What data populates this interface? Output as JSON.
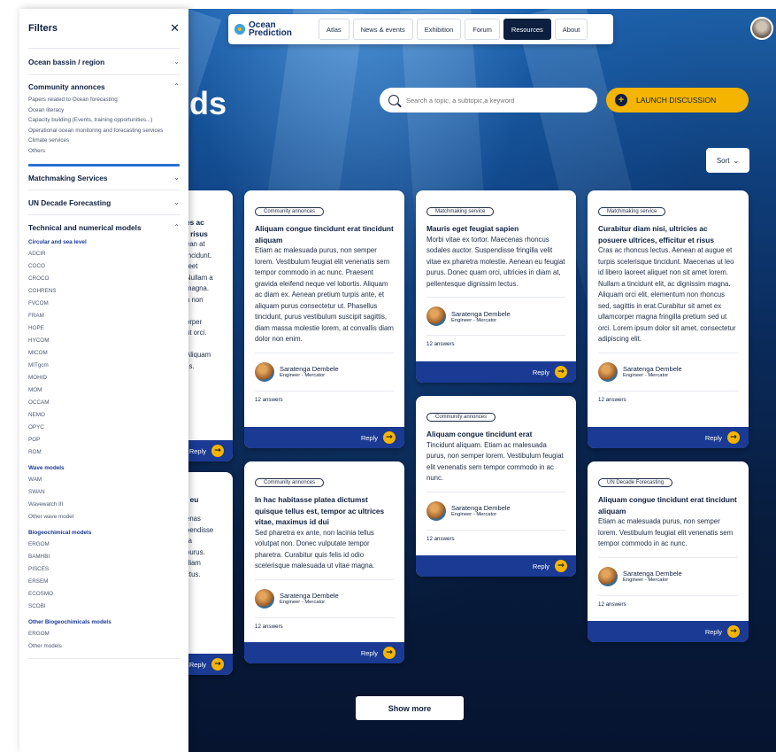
{
  "nav": {
    "logo_line1": "Ocean",
    "logo_line2": "Prediction",
    "items": [
      "Atlas",
      "News & events",
      "Exhibition",
      "Forum",
      "Resources",
      "About"
    ],
    "active": "Resources"
  },
  "hero": {
    "title_fragment": "ds"
  },
  "search": {
    "placeholder": "Search a topic, a subtopic,a keyword"
  },
  "launch_label": "LAUNCH DISCUSSION",
  "sort_label": "Sort",
  "show_more_label": "Show more",
  "filters": {
    "title": "Filters",
    "sections": {
      "ocean": "Ocean bassin / region",
      "community": "Community annonces",
      "community_items": [
        "Papers related to Ocean forecasting",
        "Ocean literacy",
        "Capacity building (Events, training opportunities...)",
        "Operational ocean monitoring and forecasting services",
        "Climate services",
        "Others"
      ],
      "matchmaking": "Matchmaking Services",
      "undecade": "UN Decade Forecasting",
      "technical": "Technical and numerical models",
      "circular_title": "Circular and sea level",
      "circular_items": [
        "ADCIR",
        "COCO",
        "CROCO",
        "COHRENS",
        "FVCOM",
        "FRAM",
        "HOPE",
        "HYCOM",
        "MICOM",
        "MITgcm",
        "MOHID",
        "MOM",
        "OCCAM",
        "NEMO",
        "OPYC",
        "POP",
        "ROM"
      ],
      "wave_title": "Wave models",
      "wave_items": [
        "WAM",
        "SWAN",
        "Wavewatch III",
        "Other wave model"
      ],
      "bio_title": "Biogeochimical models",
      "bio_items": [
        "ERGOM",
        "BAMHBI",
        "PISCES",
        "ERSEM",
        "ECOSMO",
        "SCOBI"
      ],
      "otherbio_title": "Other Biogeochimicals models",
      "otherbio_items": [
        "ERGOM",
        "Other models"
      ]
    }
  },
  "cards": {
    "c1": {
      "tag": "Community annonces",
      "title": "Aliquam congue tincidunt erat tincidunt aliquam",
      "body": "Etiam ac malesuada purus, non semper lorem. Vestibulum feugiat elit venenatis sem tempor commodo in ac nunc. Praesent gravida eleifend neque vel lobortis. Aliquam ac diam ex. Aenean pretium turpis ante, et aliquam purus consectetur ut. Phasellus tincidunt, purus vestibulum suscipit sagittis, diam massa molestie lorem, at convallis diam dolor non enim.",
      "author": "Saratenga Dembele",
      "role": "Engineer - Mercator",
      "answers": "12 answers",
      "reply": "Reply"
    },
    "c2": {
      "tag": "Matchmaking service",
      "title": "Mauris eget feugiat sapien",
      "body": "Morbi vitae ex tortor. Maecenas rhoncus sodales auctor. Suspendisse fringilla velit vitae ex pharetra molestie. Aenean eu feugiat purus. Donec quam orci, ultricies in diam at, pellentesque dignissim lectus.",
      "author": "Saratenga Dembele",
      "role": "Engineer - Mercator",
      "answers": "12 answers",
      "reply": "Reply"
    },
    "c3": {
      "tag": "Matchmaking service",
      "title": "Curabitur diam nisi, ultricies ac posuere ultrices, efficitur et risus",
      "body": "Cras ac rhoncus lectus. Aenean at augue et turpis scelerisque tincidunt. Maecenas ut leo id libero laoreet aliquet non sit amet lorem. Nullam a tincidunt elit, ac dignissim magna. Aliquam orci elit, elementum non rhoncus sed, sagittis in erat.Curabitur sit amet ex ullamcorper magna fringilla pretium sed ut orci. Lorem ipsum dolor sit amet, consectetur adipiscing elit.",
      "author": "Saratenga Dembele",
      "role": "Engineer - Mercator",
      "answers": "12 answers",
      "reply": "Reply"
    },
    "c4": {
      "tag": "Community annonces",
      "title": "Aliquam congue tincidunt erat",
      "body": "Tincidunt aliquam. Etiam ac malesuada purus, non semper lorem. Vestibulum feugiat elit venenatis sem tempor commodo in ac nunc.",
      "author": "Saratenga Dembele",
      "role": "Engineer - Mercator",
      "answers": "12 answers",
      "reply": "Reply"
    },
    "c5": {
      "tag": "Community annonces",
      "title": "In hac habitasse platea dictumst quisque tellus est, tempor ac ultrices vitae, maximus id dui",
      "body": "Sed pharetra ex ante, non lacinia tellus volutpat non. Donec vulputate tempor pharetra. Curabitur quis felis id odio scelerisque malesuada ut vitae magna.",
      "author": "Saratenga Dembele",
      "role": "Engineer - Mercator",
      "answers": "12 answers",
      "reply": "Reply"
    },
    "c6": {
      "tag": "UN Decade Forecasting",
      "title": "Aliquam congue tincidunt erat tincidunt aliquam",
      "body": "Etiam ac malesuada purus, non semper lorem. Vestibulum feugiat elit venenatis sem tempor commodo in ac nunc.",
      "author": "Saratenga Dembele",
      "role": "Engineer - Mercator",
      "answers": "12 answers",
      "reply": "Reply"
    },
    "h1": {
      "title_frag": "es ac\nt risus",
      "body_frag": "ean at\nincidunt.\nreet\nNullam a\nmagna.\nn non\n\norper\nut orci.\n\nAliquam\nlis.",
      "reply": "Reply"
    },
    "h2": {
      "title_frag": "\n, eu",
      "body_frag": "enas\npendisse\nra\npurus.\n diam\nctus.",
      "reply": "Reply"
    }
  }
}
